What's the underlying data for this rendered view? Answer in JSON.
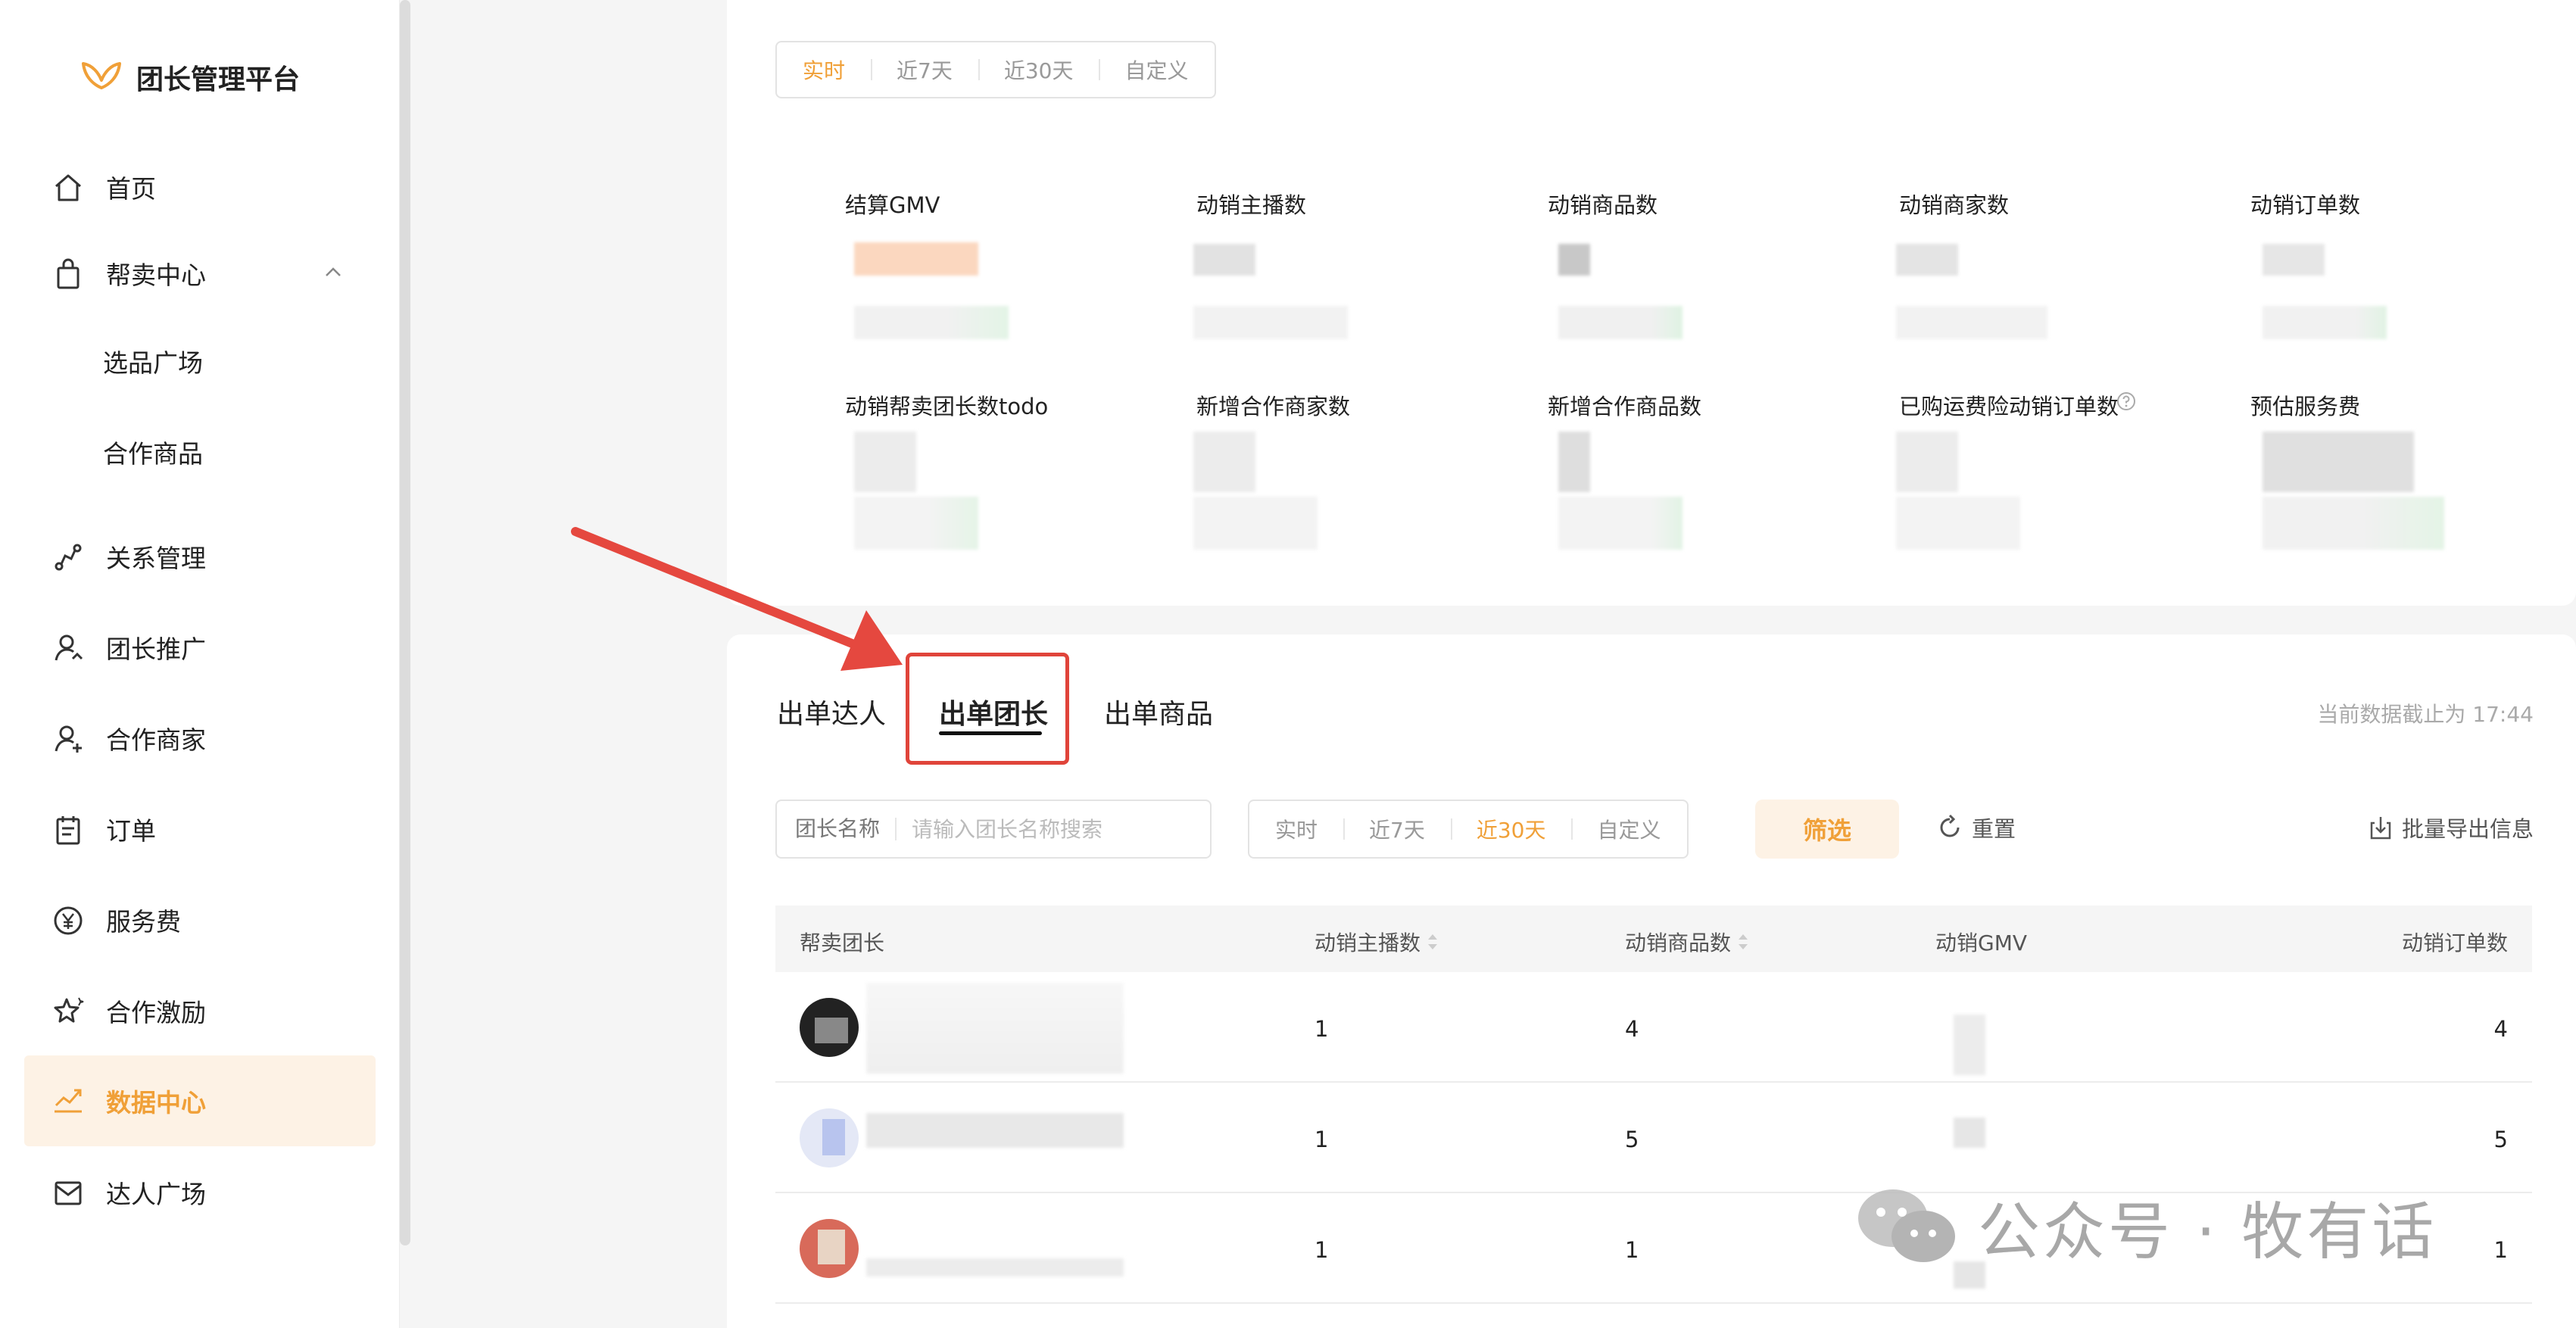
{
  "brand": {
    "name": "团长管理平台",
    "accent": "#f0a038"
  },
  "sidebar": {
    "items": [
      {
        "label": "首页",
        "icon": "home-icon"
      },
      {
        "label": "帮卖中心",
        "icon": "shopping-bag-icon",
        "expanded": true
      },
      {
        "label": "选品广场",
        "sub": true
      },
      {
        "label": "合作商品",
        "sub": true
      },
      {
        "label": "关系管理",
        "icon": "relation-icon"
      },
      {
        "label": "团长推广",
        "icon": "user-promote-icon"
      },
      {
        "label": "合作商家",
        "icon": "user-add-icon"
      },
      {
        "label": "订单",
        "icon": "clipboard-icon"
      },
      {
        "label": "服务费",
        "icon": "yen-icon"
      },
      {
        "label": "合作激励",
        "icon": "star-icon"
      },
      {
        "label": "数据中心",
        "icon": "trend-icon",
        "active": true
      },
      {
        "label": "达人广场",
        "icon": "mail-icon"
      }
    ]
  },
  "overview": {
    "time_filter": {
      "options": [
        "实时",
        "近7天",
        "近30天",
        "自定义"
      ],
      "selected": "实时"
    },
    "metrics": [
      "结算GMV",
      "动销主播数",
      "动销商品数",
      "动销商家数",
      "动销订单数",
      "动销帮卖团长数todo",
      "新增合作商家数",
      "新增合作商品数",
      "已购运费险动销订单数",
      "预估服务费"
    ]
  },
  "detail": {
    "tabs": [
      "出单达人",
      "出单团长",
      "出单商品"
    ],
    "active_tab": "出单团长",
    "data_cutoff": "当前数据截止为 17:44",
    "search": {
      "label": "团长名称",
      "placeholder": "请输入团长名称搜索"
    },
    "time_filter": {
      "options": [
        "实时",
        "近7天",
        "近30天",
        "自定义"
      ],
      "selected": "近30天"
    },
    "filter_label": "筛选",
    "reset_label": "重置",
    "export_label": "批量导出信息",
    "columns": [
      "帮卖团长",
      "动销主播数",
      "动销商品数",
      "动销GMV",
      "动销订单数"
    ],
    "rows": [
      {
        "anchors": "1",
        "products": "4",
        "orders": "4"
      },
      {
        "anchors": "1",
        "products": "5",
        "orders": "5"
      },
      {
        "anchors": "1",
        "products": "1",
        "orders": "1"
      }
    ]
  },
  "watermark": "公众号 · 牧有话"
}
